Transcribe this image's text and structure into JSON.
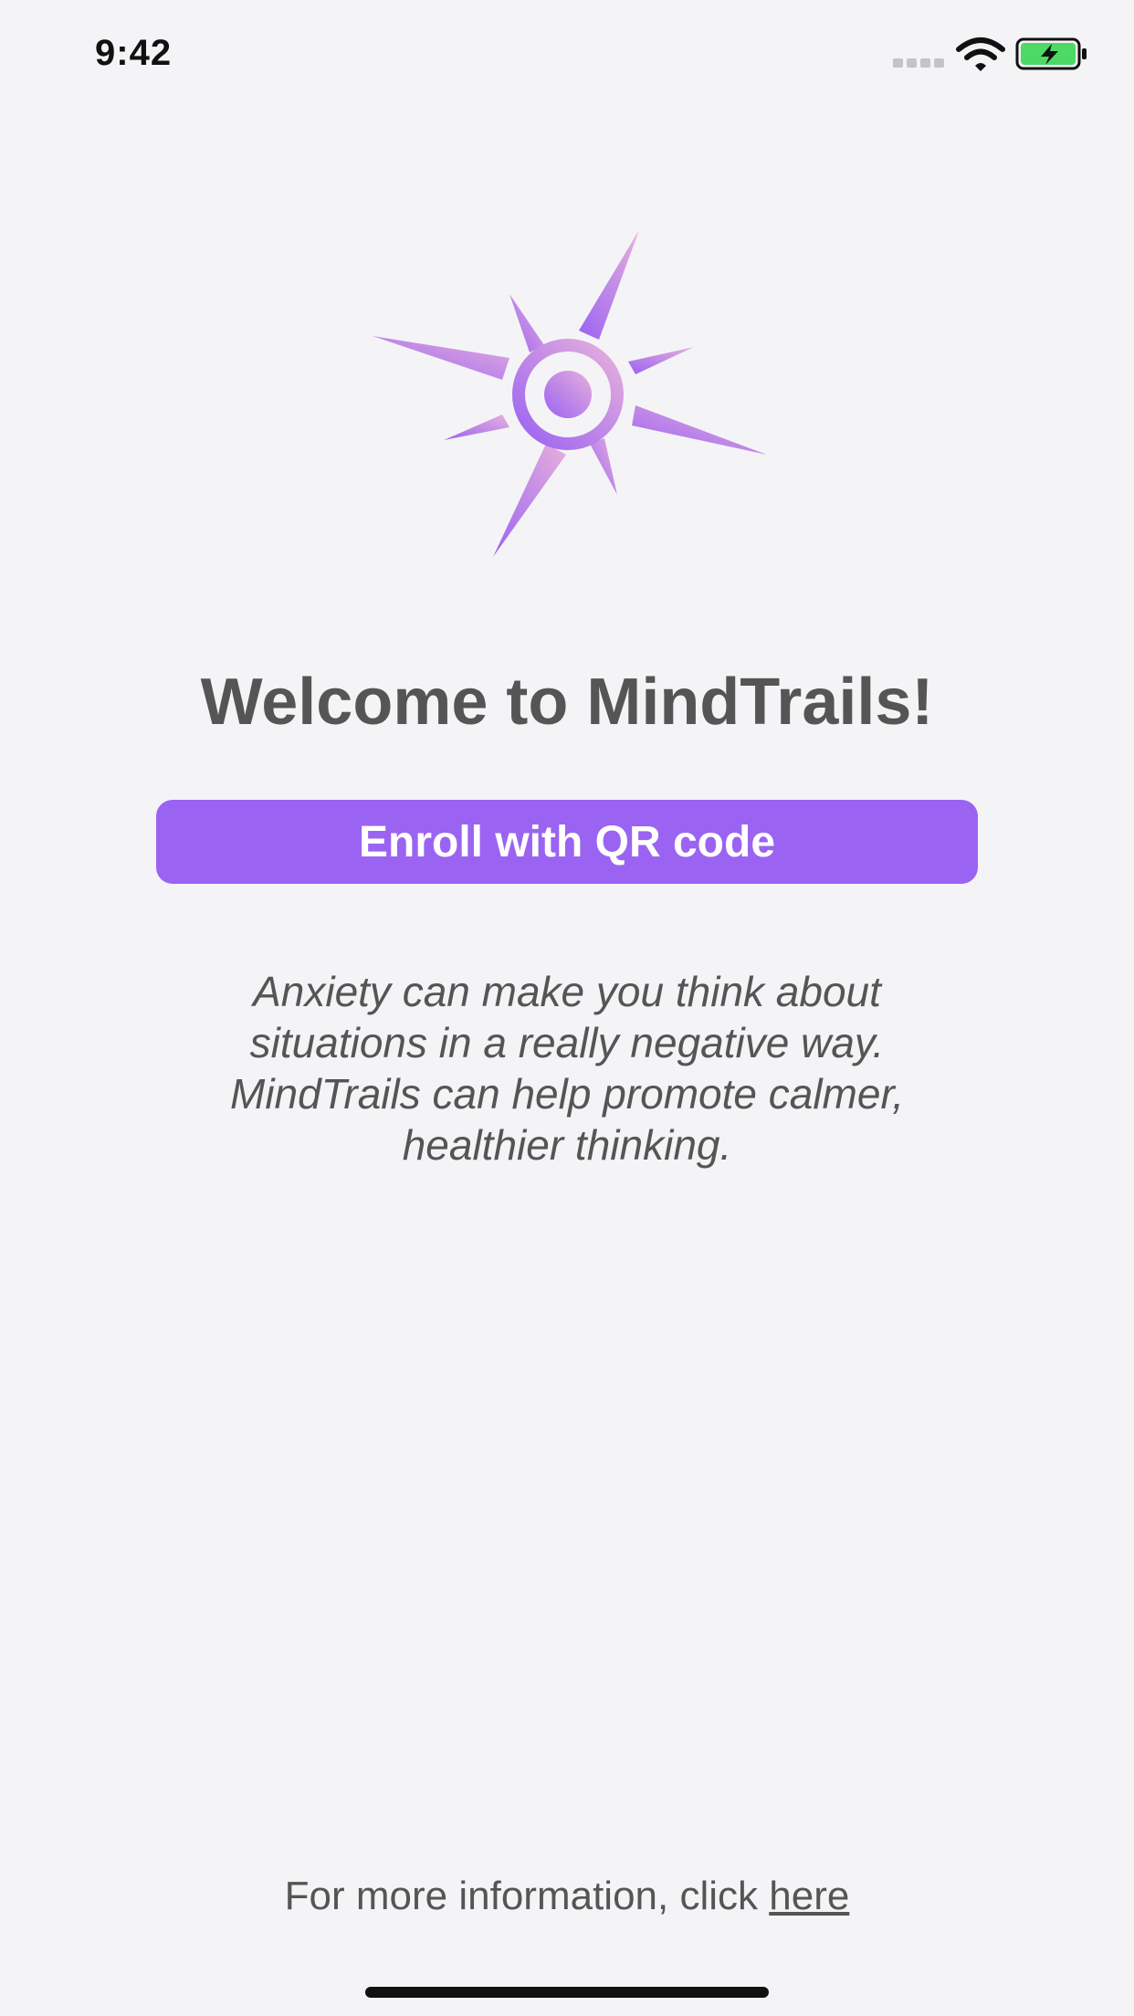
{
  "status_bar": {
    "time": "9:42",
    "icons": [
      "cellular-signal-icon",
      "wifi-icon",
      "battery-charging-icon"
    ],
    "battery_color": "#4cd964"
  },
  "logo": {
    "icon": "sun-compass-logo-icon",
    "colors": [
      "#e2a8e0",
      "#9b63f2"
    ]
  },
  "title": "Welcome to MindTrails!",
  "enroll_button": {
    "label": "Enroll with QR code",
    "color": "#9b63f2"
  },
  "description": {
    "lines": [
      "Anxiety can make you think about",
      "situations in a really negative way.",
      "MindTrails can help promote calmer,",
      "healthier thinking."
    ]
  },
  "footer": {
    "text": "For more information, click ",
    "link_label": "here"
  }
}
